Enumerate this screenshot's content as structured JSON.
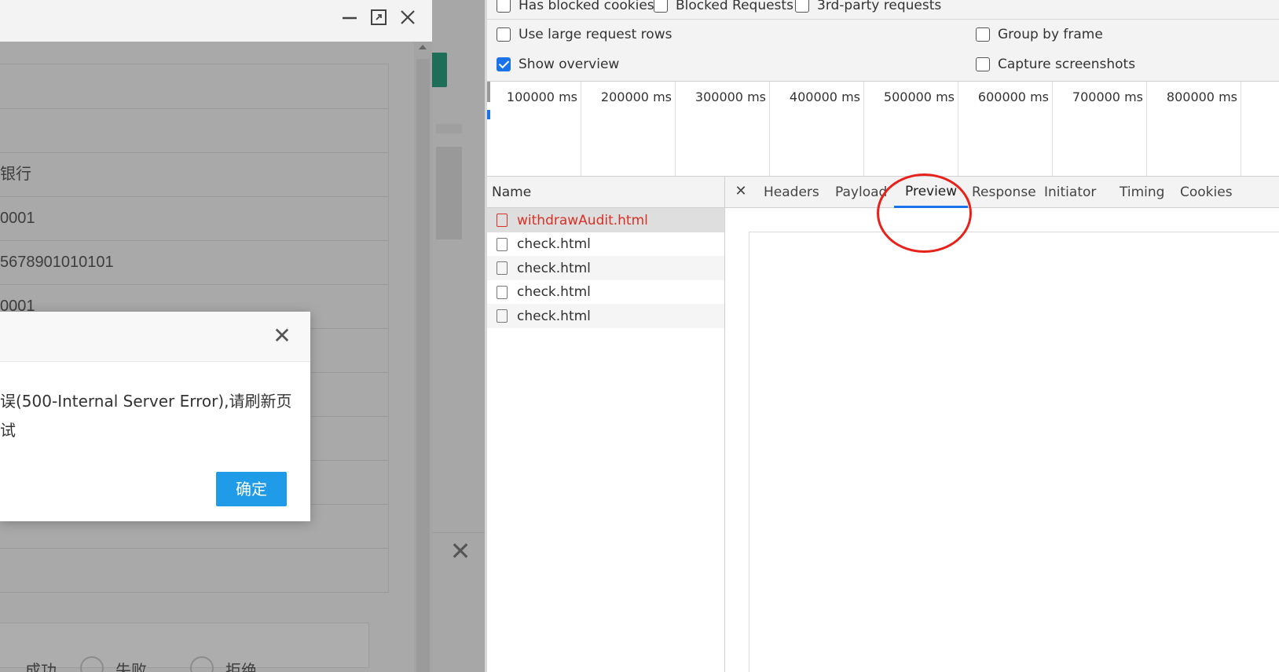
{
  "app_form": {
    "rows": [
      "",
      "",
      "银行",
      "0001",
      "5678901010101",
      "0001",
      "",
      "",
      "",
      "",
      "",
      ""
    ],
    "radio_options": [
      "成功",
      "失败",
      "拒绝"
    ]
  },
  "modal": {
    "message": "误(500-Internal Server Error),请刷新页\n试",
    "ok_label": "确定"
  },
  "devtools": {
    "filters": {
      "has_blocked_cookies": {
        "label": "Has blocked cookies",
        "checked": false
      },
      "blocked_requests": {
        "label": "Blocked Requests",
        "checked": false
      },
      "third_party": {
        "label": "3rd-party requests",
        "checked": false
      },
      "large_rows": {
        "label": "Use large request rows",
        "checked": false
      },
      "show_overview": {
        "label": "Show overview",
        "checked": true
      },
      "group_by_frame": {
        "label": "Group by frame",
        "checked": false
      },
      "capture_screenshots": {
        "label": "Capture screenshots",
        "checked": false
      }
    },
    "timeline_ticks": [
      "100000 ms",
      "200000 ms",
      "300000 ms",
      "400000 ms",
      "500000 ms",
      "600000 ms",
      "700000 ms",
      "800000 ms"
    ],
    "name_header": "Name",
    "requests": [
      {
        "name": "withdrawAudit.html",
        "state": "error-selected"
      },
      {
        "name": "check.html",
        "state": "normal"
      },
      {
        "name": "check.html",
        "state": "normal"
      },
      {
        "name": "check.html",
        "state": "normal"
      },
      {
        "name": "check.html",
        "state": "normal"
      }
    ],
    "tabs": [
      "Headers",
      "Payload",
      "Preview",
      "Response",
      "Initiator",
      "Timing",
      "Cookies"
    ],
    "active_tab": "Preview",
    "colors": {
      "accent": "#1a73e8",
      "error": "#d93025",
      "annotation": "#e8211a",
      "ok_button": "#1f9be8"
    }
  }
}
